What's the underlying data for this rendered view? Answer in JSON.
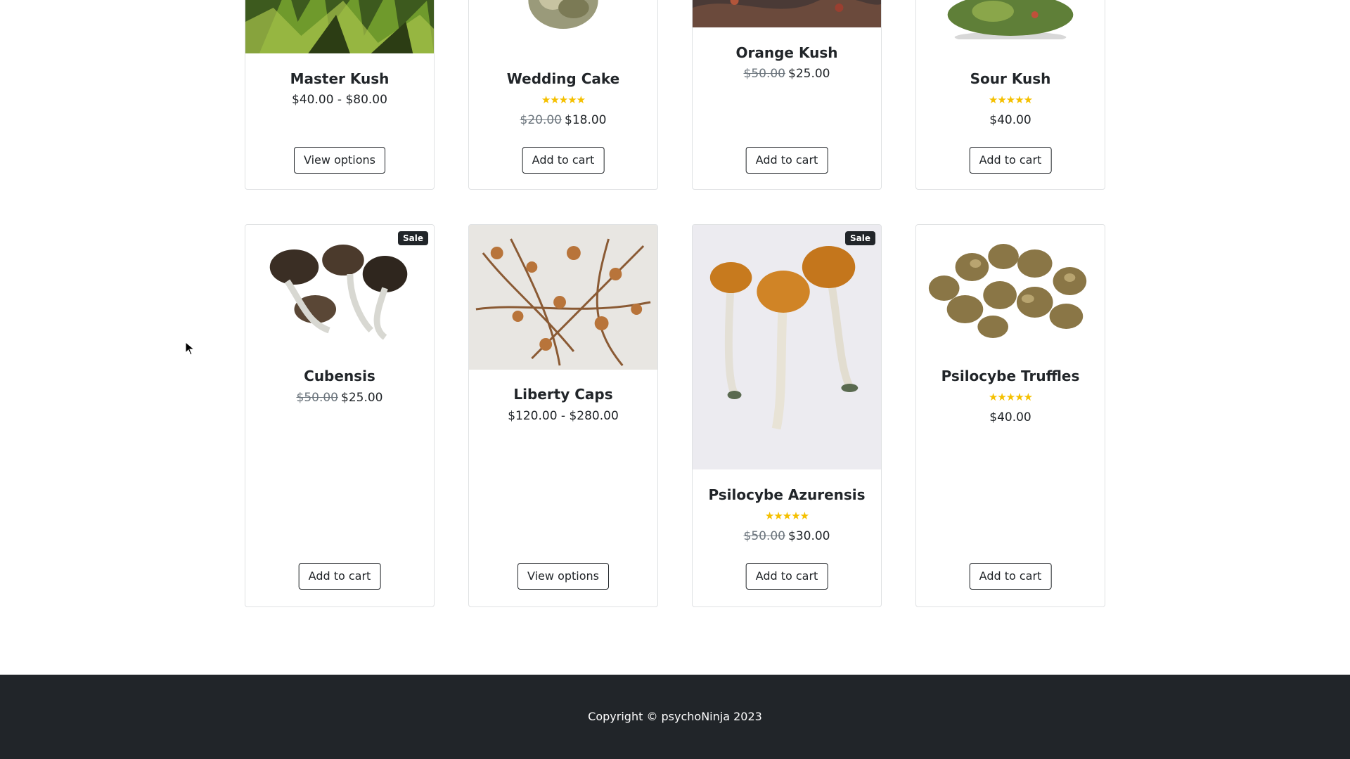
{
  "colors": {
    "accent_star": "#f5c000",
    "footer_bg": "#212529",
    "text": "#212529",
    "muted": "#6c757d"
  },
  "products_row1": [
    {
      "name": "Master Kush",
      "price": "$40.00 - $80.00",
      "button": "View options",
      "rating": null,
      "sale": false
    },
    {
      "name": "Wedding Cake",
      "old_price": "$20.00",
      "price": "$18.00",
      "button": "Add to cart",
      "rating": 5
    },
    {
      "name": "Orange Kush",
      "old_price": "$50.00",
      "price": "$25.00",
      "button": "Add to cart",
      "rating": null
    },
    {
      "name": "Sour Kush",
      "price": "$40.00",
      "button": "Add to cart",
      "rating": 5
    }
  ],
  "products_row2": [
    {
      "name": "Cubensis",
      "old_price": "$50.00",
      "price": "$25.00",
      "button": "Add to cart",
      "badge": "Sale"
    },
    {
      "name": "Liberty Caps",
      "price": "$120.00 - $280.00",
      "button": "View options"
    },
    {
      "name": "Psilocybe Azurensis",
      "old_price": "$50.00",
      "price": "$30.00",
      "button": "Add to cart",
      "badge": "Sale",
      "rating": 5
    },
    {
      "name": "Psilocybe Truffles",
      "price": "$40.00",
      "button": "Add to cart",
      "rating": 5
    }
  ],
  "stars_glyph": "★★★★★",
  "footer": {
    "copyright": "Copyright © psychoNinja 2023"
  }
}
